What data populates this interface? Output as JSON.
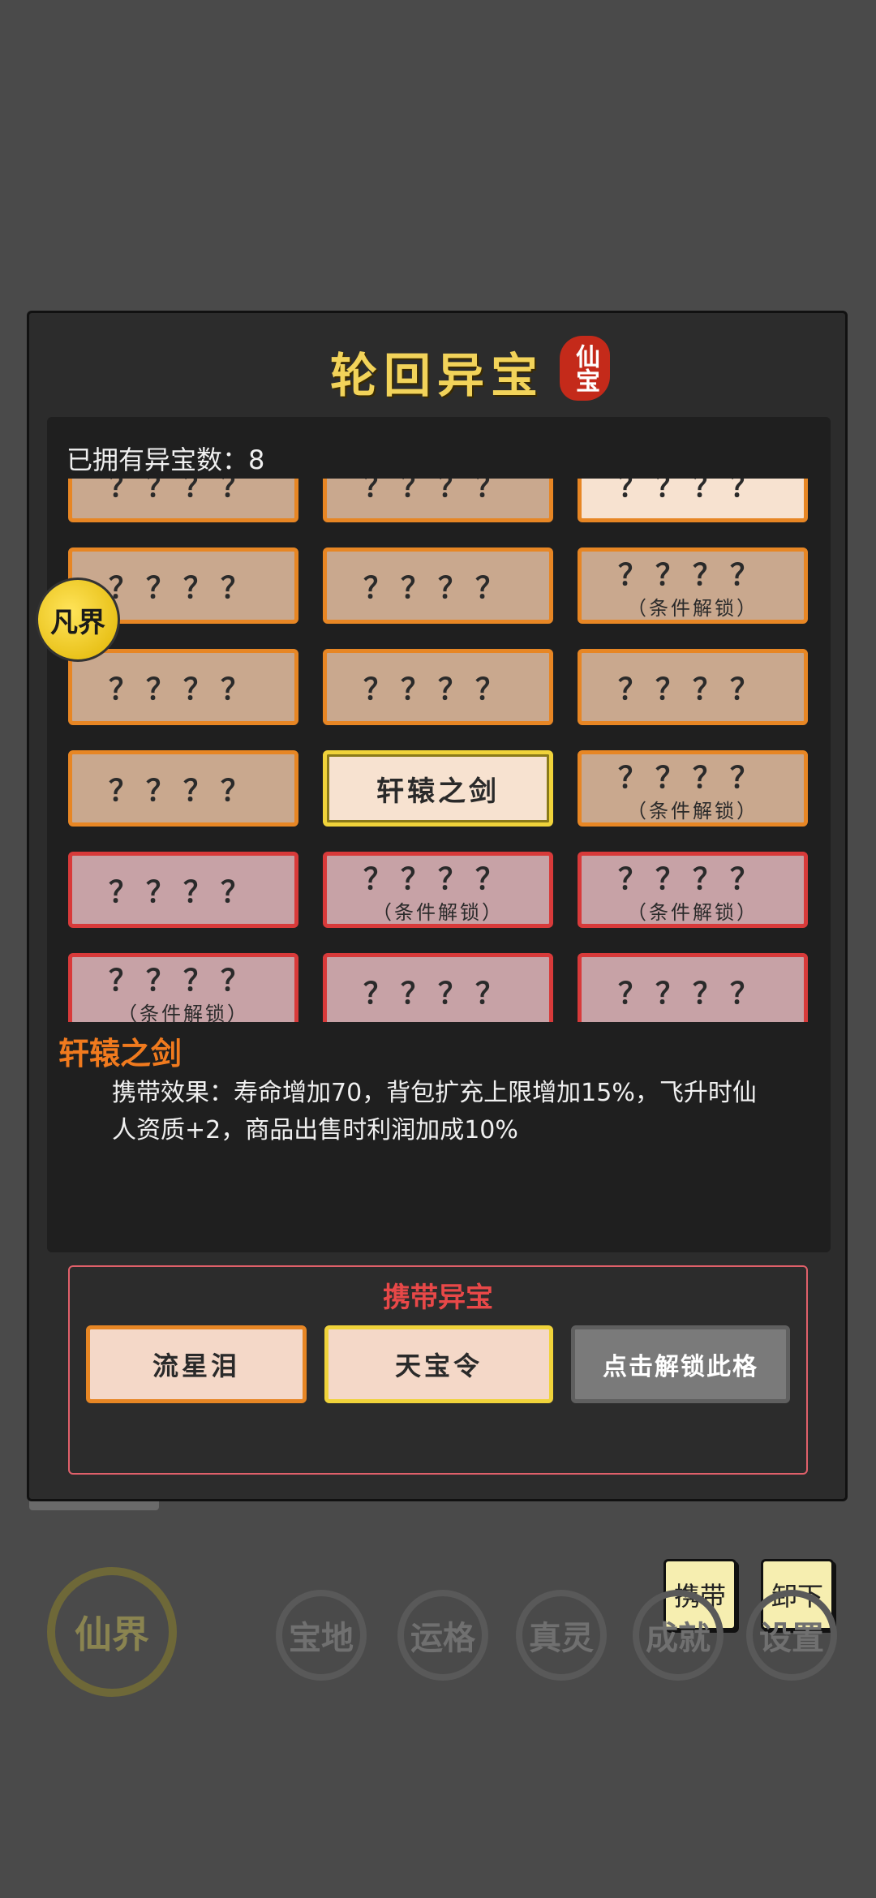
{
  "dialog": {
    "title": "轮回异宝",
    "seal": "仙宝",
    "owned_label": "已拥有异宝数：",
    "owned_count": "8"
  },
  "slots": [
    {
      "main": "？？？？",
      "sub": "",
      "style": "normal"
    },
    {
      "main": "？？？？",
      "sub": "",
      "style": "normal"
    },
    {
      "main": "？？？？",
      "sub": "",
      "style": "light"
    },
    {
      "main": "？？？？",
      "sub": "",
      "style": "normal"
    },
    {
      "main": "？？？？",
      "sub": "",
      "style": "normal"
    },
    {
      "main": "？？？？",
      "sub": "（条件解锁）",
      "style": "normal"
    },
    {
      "main": "？？？？",
      "sub": "",
      "style": "normal"
    },
    {
      "main": "？？？？",
      "sub": "",
      "style": "normal"
    },
    {
      "main": "？？？？",
      "sub": "",
      "style": "normal"
    },
    {
      "main": "？？？？",
      "sub": "",
      "style": "normal"
    },
    {
      "main": "轩辕之剑",
      "sub": "",
      "style": "selected"
    },
    {
      "main": "？？？？",
      "sub": "（条件解锁）",
      "style": "normal"
    },
    {
      "main": "？？？？",
      "sub": "",
      "style": "red"
    },
    {
      "main": "？？？？",
      "sub": "（条件解锁）",
      "style": "red"
    },
    {
      "main": "？？？？",
      "sub": "（条件解锁）",
      "style": "red"
    },
    {
      "main": "？？？？",
      "sub": "（条件解锁）",
      "style": "red"
    },
    {
      "main": "？？？？",
      "sub": "",
      "style": "red"
    },
    {
      "main": "？？？？",
      "sub": "",
      "style": "red"
    }
  ],
  "realm_badge": "凡界",
  "detail": {
    "name": "轩辕之剑",
    "effect": "携带效果：寿命增加70，背包扩充上限增加15%，飞升时仙人资质+2，商品出售时利润加成10%",
    "carry_button": "携带",
    "unequip_button": "卸下"
  },
  "carry": {
    "title": "携带异宝",
    "slots": [
      "流星泪",
      "天宝令",
      "点击解锁此格"
    ]
  },
  "nav": {
    "main": "仙界",
    "items": [
      "宝地",
      "运格",
      "真灵",
      "成就",
      "设置"
    ]
  },
  "colors": {
    "slot_border": "#e78624",
    "selected_border": "#f0d33a",
    "red_border": "#d83a3a",
    "title": "#f2d35a",
    "detail_name": "#f07a1e"
  }
}
